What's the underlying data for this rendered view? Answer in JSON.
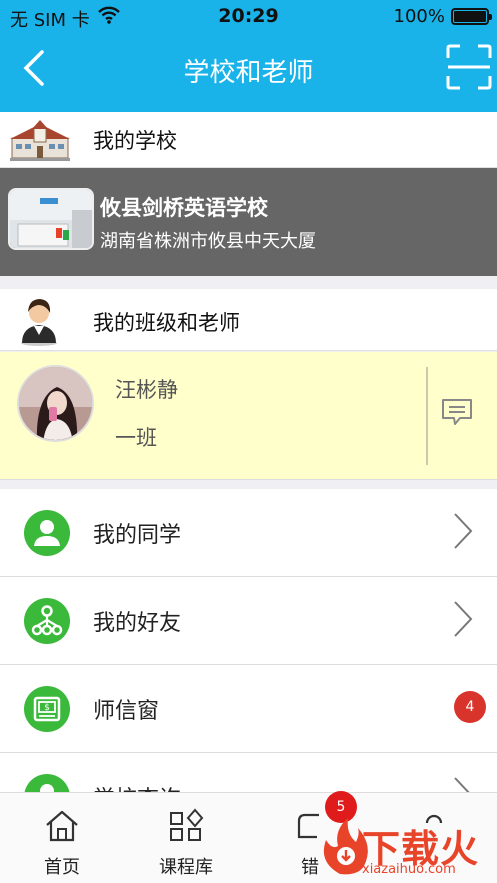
{
  "status_bar": {
    "carrier": "无 SIM 卡",
    "time": "20:29",
    "battery": "100%"
  },
  "nav": {
    "title": "学校和老师"
  },
  "school_section": {
    "label": "我的学校",
    "school_name": "攸县剑桥英语学校",
    "address": "湖南省株洲市攸县中天大厦"
  },
  "class_section": {
    "label": "我的班级和老师",
    "teacher_name": "汪彬静",
    "class_name": "一班"
  },
  "menu": [
    {
      "label": "我的同学",
      "icon": "person-icon"
    },
    {
      "label": "我的好友",
      "icon": "network-icon"
    },
    {
      "label": "师信窗",
      "icon": "certificate-icon",
      "badge": "4"
    },
    {
      "label": "学校查询",
      "icon": "person-icon"
    }
  ],
  "tabbar": {
    "tabs": [
      {
        "label": "首页",
        "icon": "home-icon"
      },
      {
        "label": "课程库",
        "icon": "grid-icon"
      },
      {
        "label": "错",
        "icon": "book-icon",
        "badge": "5"
      },
      {
        "label": "",
        "icon": "profile-icon"
      }
    ]
  },
  "watermark": {
    "text": "下载火",
    "sub": "xiazaihuo.com"
  },
  "colors": {
    "header": "#1ab3e9",
    "school_card": "#666666",
    "teacher_card": "#ffffcc",
    "menu_icon": "#3bb93b",
    "badge": "#d8342c"
  }
}
